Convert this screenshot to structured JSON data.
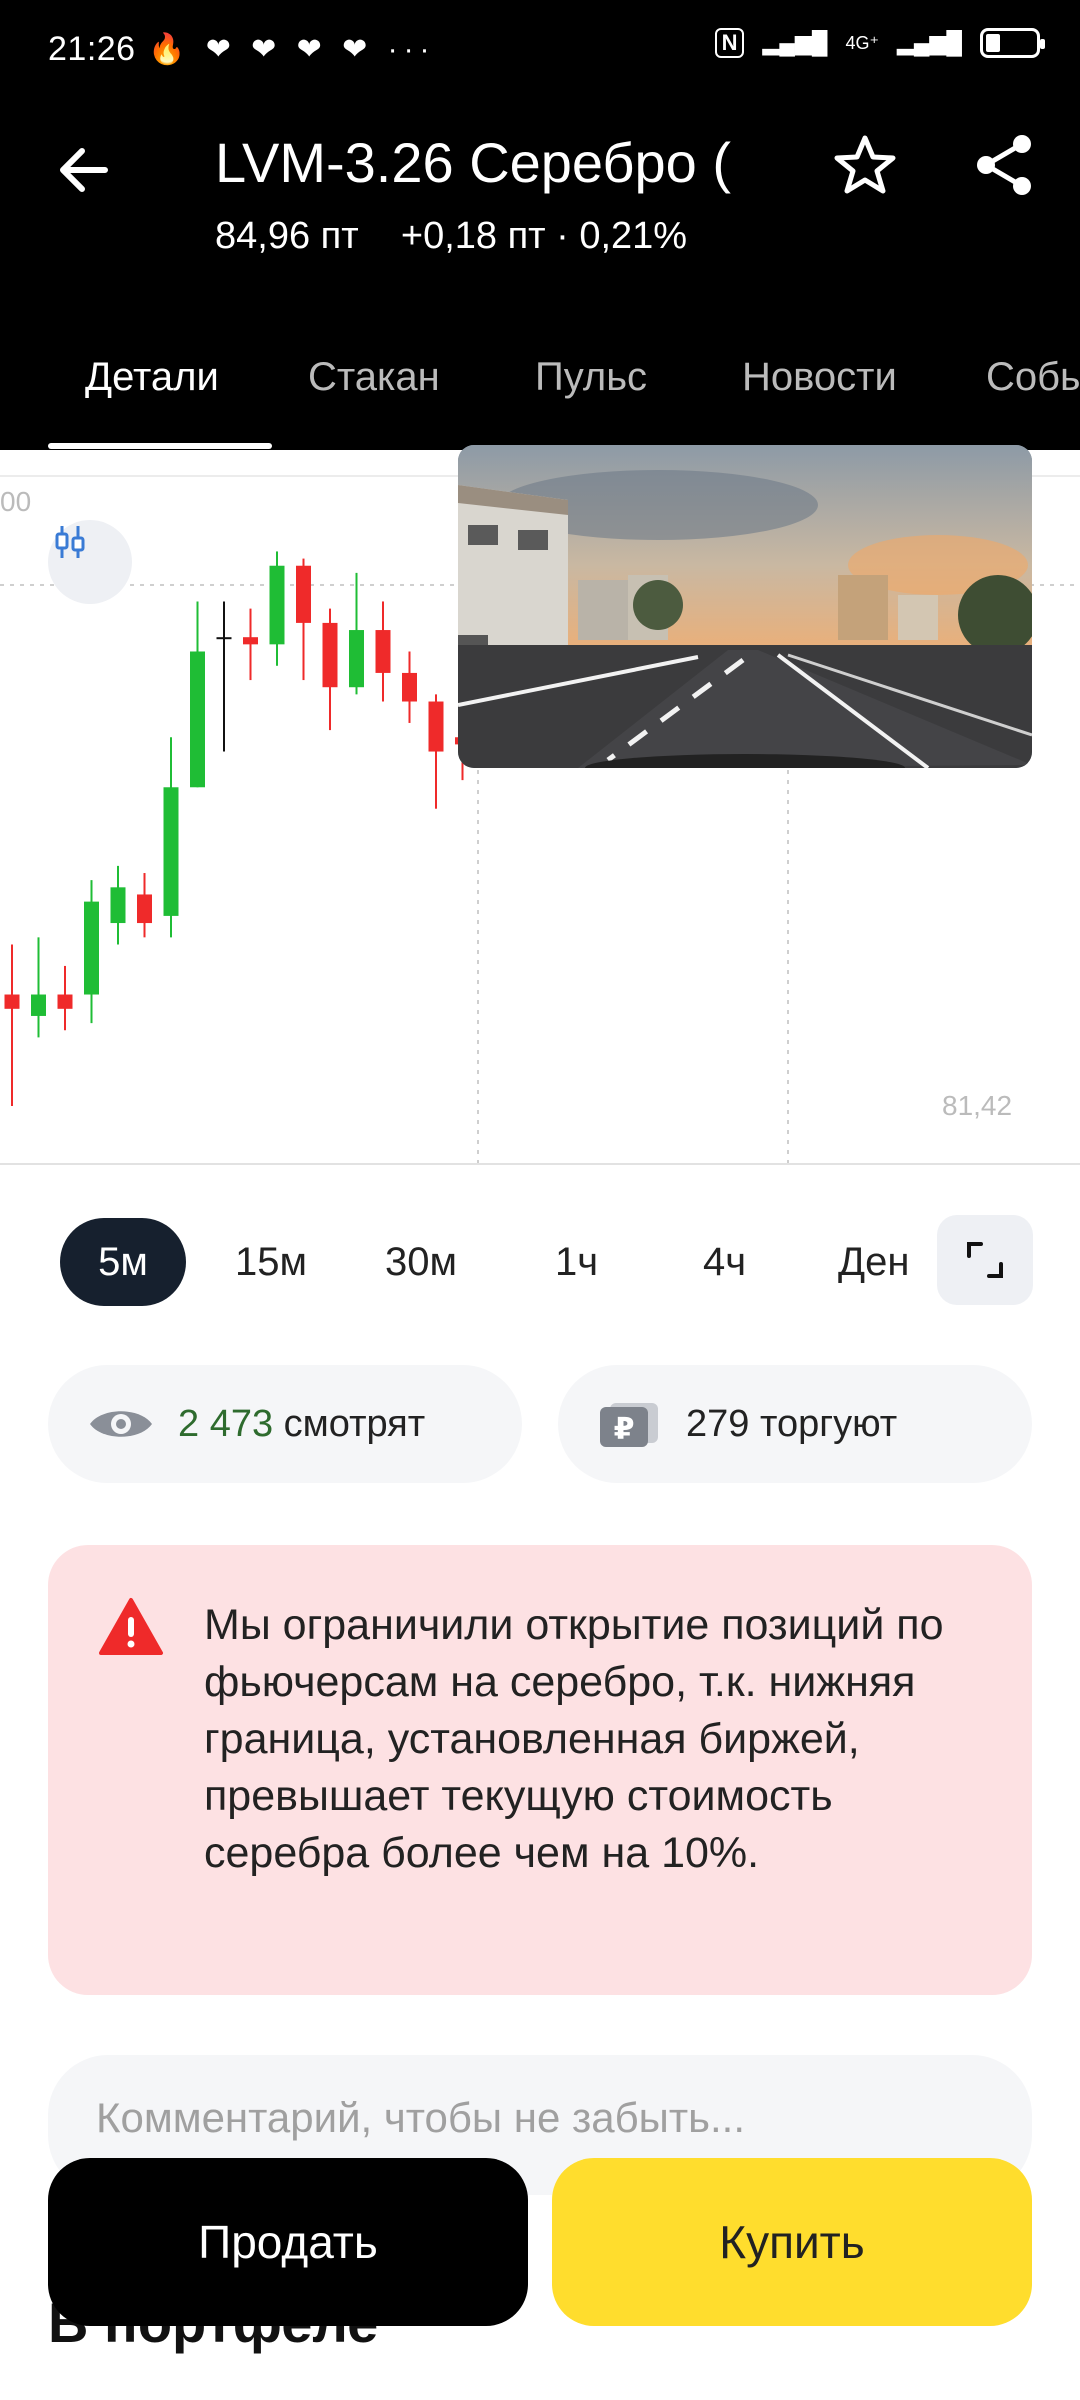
{
  "status_bar": {
    "time": "21:26",
    "left_icons": "🔥 ❤ ❤ ❤ ❤ ···",
    "nfc": "N",
    "network": "4G⁺",
    "signal": "▂▄▆█"
  },
  "header": {
    "title": "LVM-3.26 Серебро (",
    "price": "84,96 пт",
    "change": "+0,18 пт · 0,21%"
  },
  "tabs": [
    {
      "label": "Детали",
      "active": true
    },
    {
      "label": "Стакан",
      "active": false
    },
    {
      "label": "Пульс",
      "active": false
    },
    {
      "label": "Новости",
      "active": false
    },
    {
      "label": "Собы",
      "active": false
    }
  ],
  "chart_data": {
    "type": "candlestick",
    "top_label": "00",
    "bottom_label": "81,42",
    "candles": [
      {
        "o": 82.1,
        "c": 82.2,
        "h": 82.55,
        "l": 81.42,
        "dir": "down"
      },
      {
        "o": 82.05,
        "c": 82.2,
        "h": 82.6,
        "l": 81.9,
        "dir": "up"
      },
      {
        "o": 82.2,
        "c": 82.1,
        "h": 82.4,
        "l": 81.95,
        "dir": "down"
      },
      {
        "o": 82.2,
        "c": 82.85,
        "h": 83.0,
        "l": 82.0,
        "dir": "up"
      },
      {
        "o": 82.7,
        "c": 82.95,
        "h": 83.1,
        "l": 82.55,
        "dir": "up"
      },
      {
        "o": 82.9,
        "c": 82.7,
        "h": 83.05,
        "l": 82.6,
        "dir": "down"
      },
      {
        "o": 82.75,
        "c": 83.65,
        "h": 84.0,
        "l": 82.6,
        "dir": "up"
      },
      {
        "o": 83.65,
        "c": 84.6,
        "h": 84.95,
        "l": 83.65,
        "dir": "up"
      },
      {
        "o": 84.7,
        "c": 84.7,
        "h": 84.95,
        "l": 83.9,
        "dir": "flat"
      },
      {
        "o": 84.7,
        "c": 84.65,
        "h": 84.9,
        "l": 84.4,
        "dir": "down"
      },
      {
        "o": 84.65,
        "c": 85.2,
        "h": 85.3,
        "l": 84.5,
        "dir": "up"
      },
      {
        "o": 85.2,
        "c": 84.8,
        "h": 85.25,
        "l": 84.4,
        "dir": "down"
      },
      {
        "o": 84.8,
        "c": 84.35,
        "h": 84.9,
        "l": 84.05,
        "dir": "down"
      },
      {
        "o": 84.35,
        "c": 84.75,
        "h": 85.15,
        "l": 84.3,
        "dir": "up"
      },
      {
        "o": 84.75,
        "c": 84.45,
        "h": 84.95,
        "l": 84.25,
        "dir": "down"
      },
      {
        "o": 84.45,
        "c": 84.25,
        "h": 84.6,
        "l": 84.1,
        "dir": "down"
      },
      {
        "o": 84.25,
        "c": 83.9,
        "h": 84.3,
        "l": 83.5,
        "dir": "down"
      },
      {
        "o": 84.0,
        "c": 83.95,
        "h": 84.1,
        "l": 83.7,
        "dir": "down"
      }
    ]
  },
  "timeframes": [
    {
      "label": "5м",
      "active": true
    },
    {
      "label": "15м",
      "active": false
    },
    {
      "label": "30м",
      "active": false
    },
    {
      "label": "1ч",
      "active": false
    },
    {
      "label": "4ч",
      "active": false
    },
    {
      "label": "Ден",
      "active": false
    }
  ],
  "stats": {
    "watching_count": "2 473",
    "watching_label": " смотрят",
    "trading_count": "279",
    "trading_label": " торгуют"
  },
  "alert": {
    "text": "Мы ограничили открытие позиций по фьючерсам на серебро, т.к. нижняя граница, установленная биржей, превышает текущую стоимость серебра более чем на 10%.",
    "color": "#fde1e3"
  },
  "comment": {
    "placeholder": "Комментарий, чтобы не забыть..."
  },
  "portfolio_title": "В портфеле",
  "actions": {
    "sell_label": "Продать",
    "buy_label": "Купить"
  },
  "colors": {
    "up": "#1fbd35",
    "down": "#ef2a2a",
    "accent": "#ffdd2d",
    "header_bg": "#000000"
  }
}
